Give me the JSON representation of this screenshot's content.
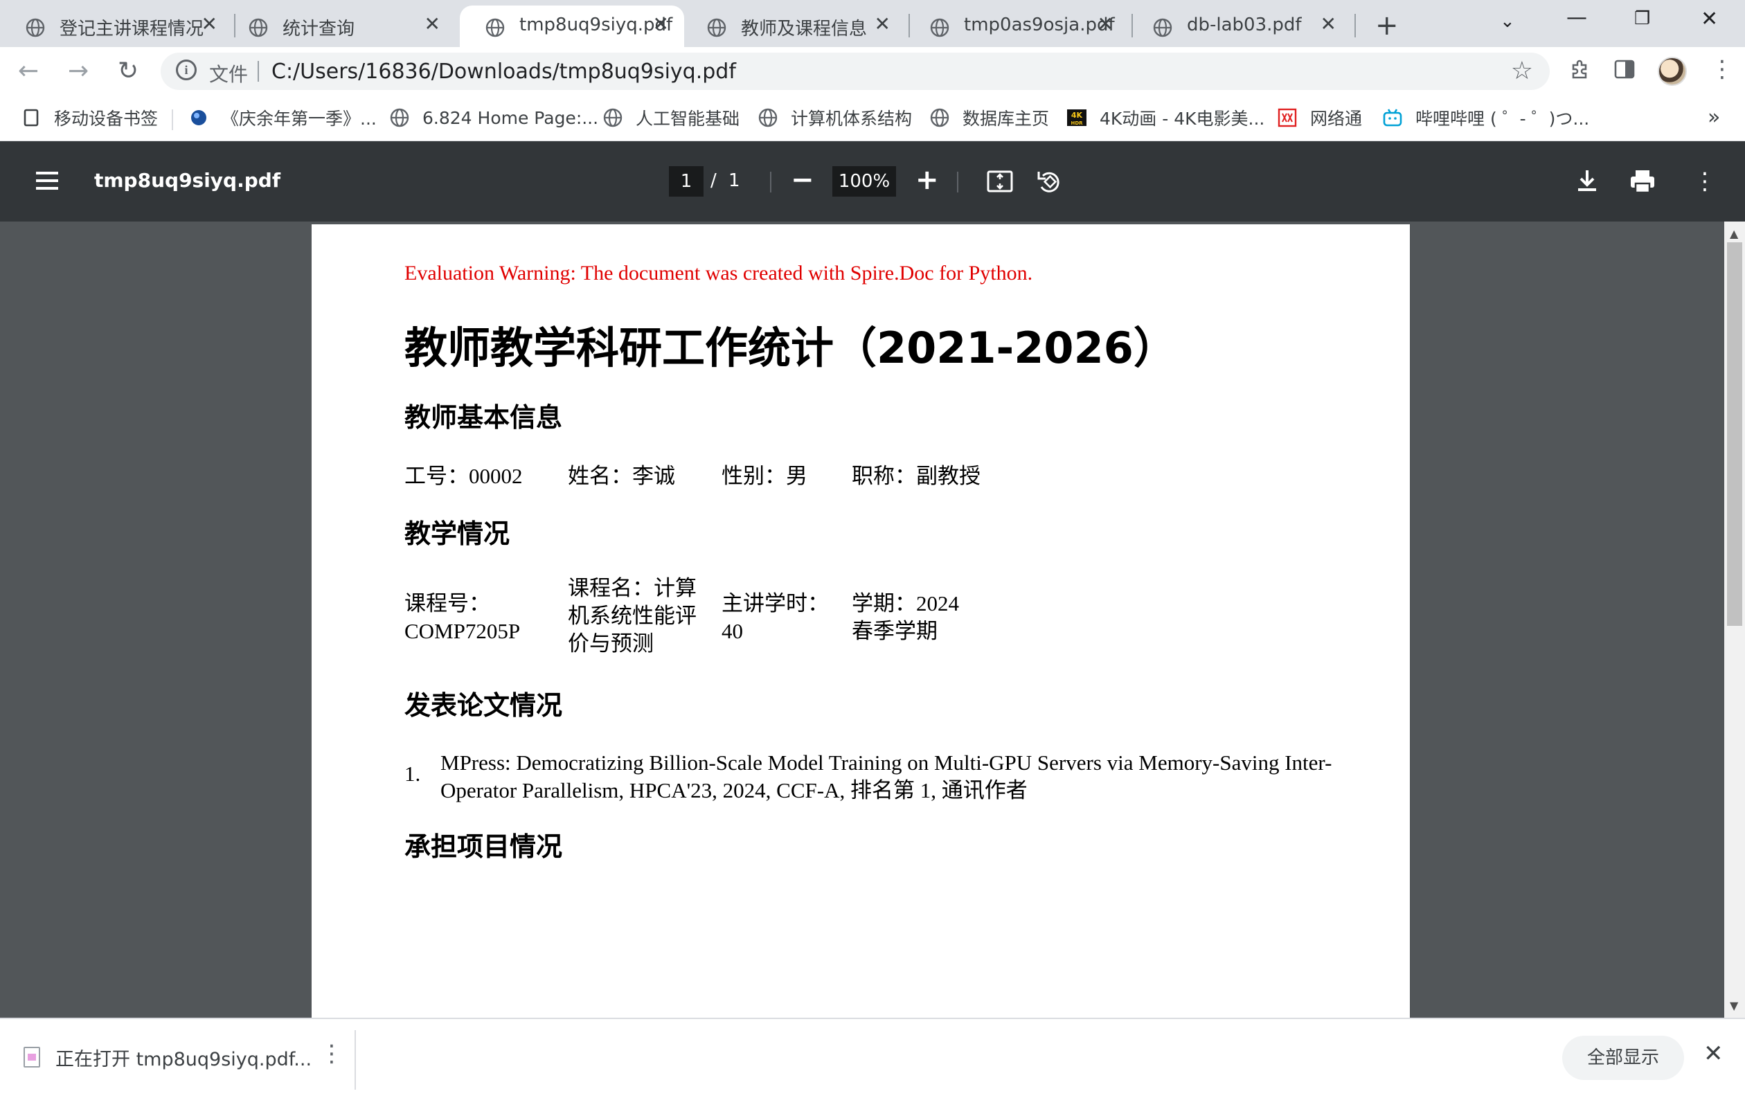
{
  "tabs": [
    {
      "label": "登记主讲课程情况"
    },
    {
      "label": "统计查询"
    },
    {
      "label": "tmp8uq9siyq.pdf"
    },
    {
      "label": "教师及课程信息"
    },
    {
      "label": "tmp0as9osja.pdf"
    },
    {
      "label": "db-lab03.pdf"
    }
  ],
  "active_tab_index": 2,
  "address": {
    "chip": "文件",
    "url": "C:/Users/16836/Downloads/tmp8uq9siyq.pdf"
  },
  "bookmarks": [
    {
      "label": "移动设备书签",
      "icon": "mobile-bookmarks-icon"
    },
    {
      "label": "《庆余年第一季》...",
      "icon": "globe-blue-icon"
    },
    {
      "label": "6.824 Home Page:...",
      "icon": "globe-icon"
    },
    {
      "label": "人工智能基础",
      "icon": "globe-icon"
    },
    {
      "label": "计算机体系结构",
      "icon": "globe-icon"
    },
    {
      "label": "数据库主页",
      "icon": "globe-icon"
    },
    {
      "label": "4K动画 - 4K电影美...",
      "icon": "4k-hdr-icon"
    },
    {
      "label": "网络通",
      "icon": "wangluotong-icon"
    },
    {
      "label": "哔哩哔哩 ( ゜- ゜)つ...",
      "icon": "bilibili-icon"
    }
  ],
  "pdf": {
    "title": "tmp8uq9siyq.pdf",
    "current_page": "1",
    "page_sep": "/",
    "total_pages": "1",
    "zoom": "100%"
  },
  "document": {
    "warning": "Evaluation Warning: The document was created with Spire.Doc for Python.",
    "title": "教师教学科研工作统计（2021-2026）",
    "sections": {
      "basic_info": "教师基本信息",
      "teaching": "教学情况",
      "papers": "发表论文情况",
      "projects": "承担项目情况"
    },
    "teacher": {
      "id": "工号：00002",
      "name": "姓名：李诚",
      "gender": "性别：男",
      "title": "职称：副教授"
    },
    "course": {
      "number": "课程号：COMP7205P",
      "name": "课程名：计算机系统性能评价与预测",
      "hours": "主讲学时：40",
      "semester": "学期：2024 春季学期"
    },
    "papers": [
      {
        "num": "1.",
        "text": "MPress: Democratizing Billion-Scale Model Training on Multi-GPU Servers via Memory-Saving Inter-Operator Parallelism, HPCA'23, 2024, CCF-A, 排名第 1, 通讯作者"
      }
    ]
  },
  "download": {
    "status": "正在打开 tmp8uq9siyq.pdf...",
    "show_all": "全部显示"
  },
  "colors": {
    "tabstrip": "#dee1e6",
    "pdf_toolbar": "#323639",
    "viewer_bg": "#525659",
    "warning_text": "#e00000"
  }
}
